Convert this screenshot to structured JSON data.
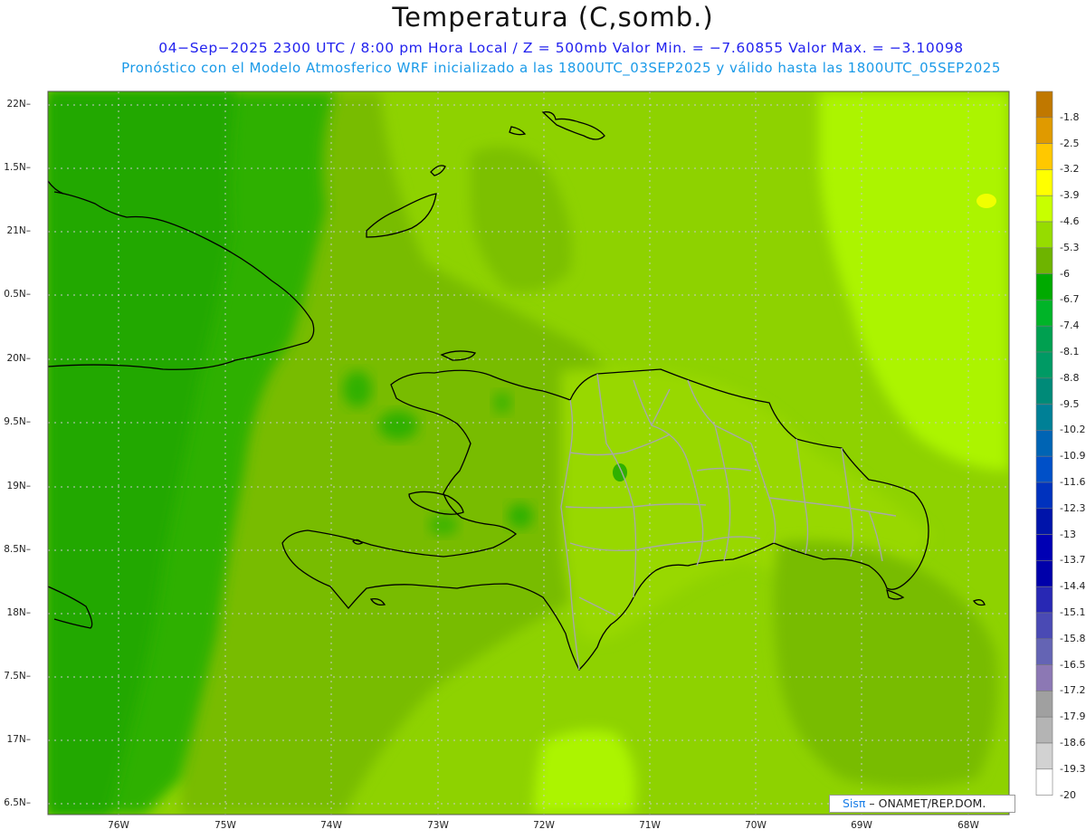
{
  "header": {
    "title": "Temperatura (C,somb.)",
    "subtitle_line1": "04−Sep−2025  2300 UTC / 8:00 pm Hora Local / Z = 500mb  Valor Min. = −7.60855  Valor Max. = −3.10098",
    "subtitle_line2": "Pronóstico con el Modelo Atmosferico WRF inicializado a las 1800UTC_03SEP2025 y válido hasta las  1800UTC_05SEP2025"
  },
  "map": {
    "lat_labels": [
      "22N",
      "1.5N",
      "21N",
      "0.5N",
      "20N",
      "9.5N",
      "19N",
      "8.5N",
      "18N",
      "7.5N",
      "17N",
      "6.5N"
    ],
    "lon_labels": [
      "76W",
      "75W",
      "74W",
      "73W",
      "72W",
      "71W",
      "70W",
      "69W",
      "68W"
    ]
  },
  "colorbar": {
    "colors": [
      "#c07800",
      "#e09a00",
      "#ffc800",
      "#ffff00",
      "#c8ff00",
      "#96dc00",
      "#6eb400",
      "#00aa00",
      "#00b428",
      "#00a050",
      "#009a64",
      "#008a78",
      "#008096",
      "#0064b4",
      "#0050c8",
      "#0032be",
      "#0014aa",
      "#0000b4",
      "#0000aa",
      "#2828b4",
      "#4a4ab4",
      "#6464b4",
      "#8c78b4",
      "#a0a0a0",
      "#b4b4b4",
      "#d2d2d2",
      "#ffffff"
    ],
    "labels": [
      "-1.8",
      "-2.5",
      "-3.2",
      "-3.9",
      "-4.6",
      "-5.3",
      "-6",
      "-6.7",
      "-7.4",
      "-8.1",
      "-8.8",
      "-9.5",
      "-10.2",
      "-10.9",
      "-11.6",
      "-12.3",
      "-13",
      "-13.7",
      "-14.4",
      "-15.1",
      "-15.8",
      "-16.5",
      "-17.2",
      "-17.9",
      "-18.6",
      "-19.3",
      "-20"
    ]
  },
  "credit": {
    "logo": "Sisπ",
    "text": " – ONAMET/REP.DOM."
  }
}
